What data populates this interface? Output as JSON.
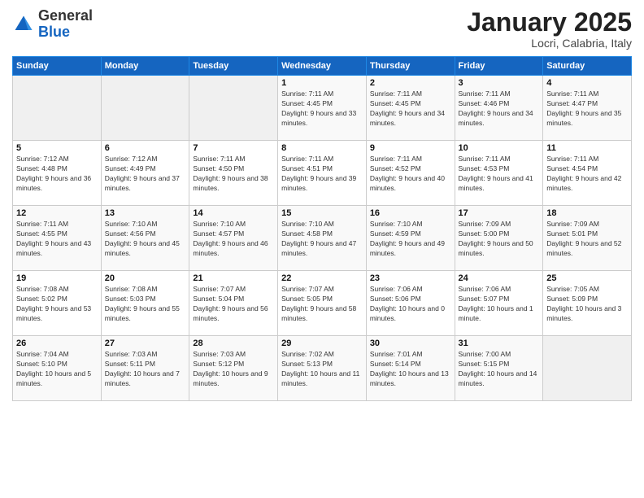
{
  "header": {
    "logo_general": "General",
    "logo_blue": "Blue",
    "month_title": "January 2025",
    "location": "Locri, Calabria, Italy"
  },
  "weekdays": [
    "Sunday",
    "Monday",
    "Tuesday",
    "Wednesday",
    "Thursday",
    "Friday",
    "Saturday"
  ],
  "weeks": [
    [
      {
        "day": "",
        "empty": true
      },
      {
        "day": "",
        "empty": true
      },
      {
        "day": "",
        "empty": true
      },
      {
        "day": "1",
        "sunrise": "7:11 AM",
        "sunset": "4:45 PM",
        "daylight": "9 hours and 33 minutes."
      },
      {
        "day": "2",
        "sunrise": "7:11 AM",
        "sunset": "4:45 PM",
        "daylight": "9 hours and 34 minutes."
      },
      {
        "day": "3",
        "sunrise": "7:11 AM",
        "sunset": "4:46 PM",
        "daylight": "9 hours and 34 minutes."
      },
      {
        "day": "4",
        "sunrise": "7:11 AM",
        "sunset": "4:47 PM",
        "daylight": "9 hours and 35 minutes."
      }
    ],
    [
      {
        "day": "5",
        "sunrise": "7:12 AM",
        "sunset": "4:48 PM",
        "daylight": "9 hours and 36 minutes."
      },
      {
        "day": "6",
        "sunrise": "7:12 AM",
        "sunset": "4:49 PM",
        "daylight": "9 hours and 37 minutes."
      },
      {
        "day": "7",
        "sunrise": "7:11 AM",
        "sunset": "4:50 PM",
        "daylight": "9 hours and 38 minutes."
      },
      {
        "day": "8",
        "sunrise": "7:11 AM",
        "sunset": "4:51 PM",
        "daylight": "9 hours and 39 minutes."
      },
      {
        "day": "9",
        "sunrise": "7:11 AM",
        "sunset": "4:52 PM",
        "daylight": "9 hours and 40 minutes."
      },
      {
        "day": "10",
        "sunrise": "7:11 AM",
        "sunset": "4:53 PM",
        "daylight": "9 hours and 41 minutes."
      },
      {
        "day": "11",
        "sunrise": "7:11 AM",
        "sunset": "4:54 PM",
        "daylight": "9 hours and 42 minutes."
      }
    ],
    [
      {
        "day": "12",
        "sunrise": "7:11 AM",
        "sunset": "4:55 PM",
        "daylight": "9 hours and 43 minutes."
      },
      {
        "day": "13",
        "sunrise": "7:10 AM",
        "sunset": "4:56 PM",
        "daylight": "9 hours and 45 minutes."
      },
      {
        "day": "14",
        "sunrise": "7:10 AM",
        "sunset": "4:57 PM",
        "daylight": "9 hours and 46 minutes."
      },
      {
        "day": "15",
        "sunrise": "7:10 AM",
        "sunset": "4:58 PM",
        "daylight": "9 hours and 47 minutes."
      },
      {
        "day": "16",
        "sunrise": "7:10 AM",
        "sunset": "4:59 PM",
        "daylight": "9 hours and 49 minutes."
      },
      {
        "day": "17",
        "sunrise": "7:09 AM",
        "sunset": "5:00 PM",
        "daylight": "9 hours and 50 minutes."
      },
      {
        "day": "18",
        "sunrise": "7:09 AM",
        "sunset": "5:01 PM",
        "daylight": "9 hours and 52 minutes."
      }
    ],
    [
      {
        "day": "19",
        "sunrise": "7:08 AM",
        "sunset": "5:02 PM",
        "daylight": "9 hours and 53 minutes."
      },
      {
        "day": "20",
        "sunrise": "7:08 AM",
        "sunset": "5:03 PM",
        "daylight": "9 hours and 55 minutes."
      },
      {
        "day": "21",
        "sunrise": "7:07 AM",
        "sunset": "5:04 PM",
        "daylight": "9 hours and 56 minutes."
      },
      {
        "day": "22",
        "sunrise": "7:07 AM",
        "sunset": "5:05 PM",
        "daylight": "9 hours and 58 minutes."
      },
      {
        "day": "23",
        "sunrise": "7:06 AM",
        "sunset": "5:06 PM",
        "daylight": "10 hours and 0 minutes."
      },
      {
        "day": "24",
        "sunrise": "7:06 AM",
        "sunset": "5:07 PM",
        "daylight": "10 hours and 1 minute."
      },
      {
        "day": "25",
        "sunrise": "7:05 AM",
        "sunset": "5:09 PM",
        "daylight": "10 hours and 3 minutes."
      }
    ],
    [
      {
        "day": "26",
        "sunrise": "7:04 AM",
        "sunset": "5:10 PM",
        "daylight": "10 hours and 5 minutes."
      },
      {
        "day": "27",
        "sunrise": "7:03 AM",
        "sunset": "5:11 PM",
        "daylight": "10 hours and 7 minutes."
      },
      {
        "day": "28",
        "sunrise": "7:03 AM",
        "sunset": "5:12 PM",
        "daylight": "10 hours and 9 minutes."
      },
      {
        "day": "29",
        "sunrise": "7:02 AM",
        "sunset": "5:13 PM",
        "daylight": "10 hours and 11 minutes."
      },
      {
        "day": "30",
        "sunrise": "7:01 AM",
        "sunset": "5:14 PM",
        "daylight": "10 hours and 13 minutes."
      },
      {
        "day": "31",
        "sunrise": "7:00 AM",
        "sunset": "5:15 PM",
        "daylight": "10 hours and 14 minutes."
      },
      {
        "day": "",
        "empty": true
      }
    ]
  ]
}
